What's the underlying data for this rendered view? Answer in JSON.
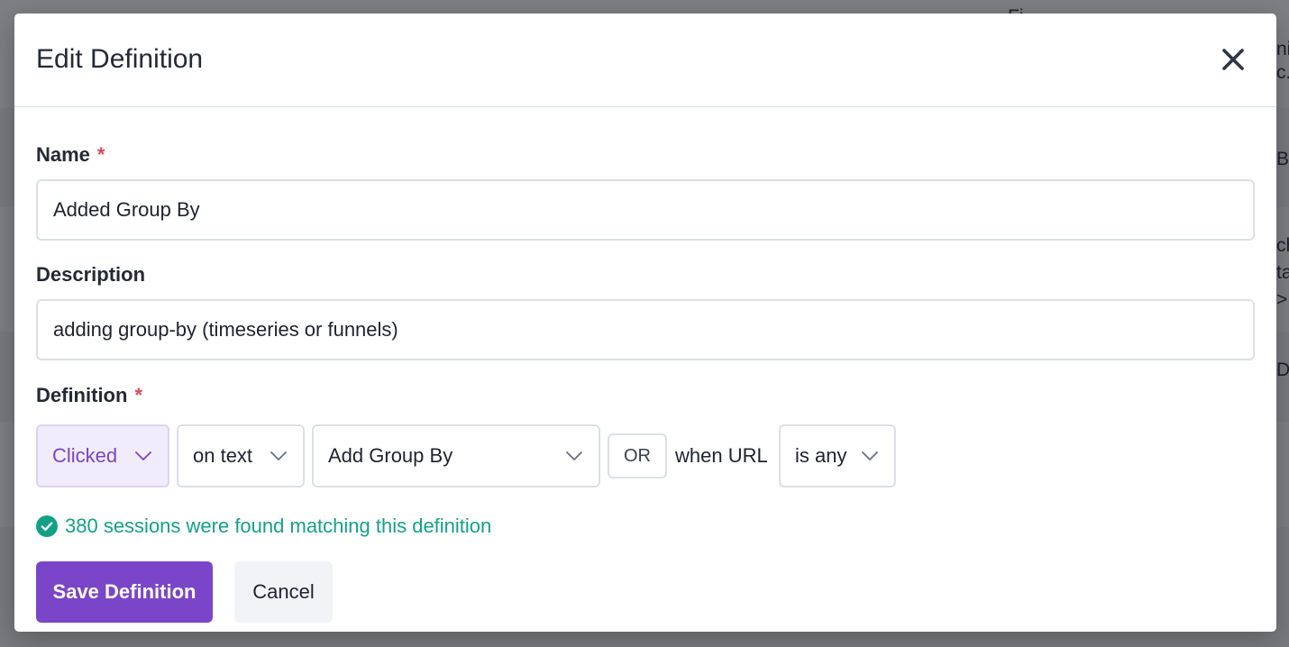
{
  "background": {
    "fragments": [
      "Fi",
      "nil",
      "c.",
      "By",
      "ch",
      "ta",
      ">",
      "D"
    ]
  },
  "modal": {
    "title": "Edit Definition",
    "close_icon": "close-icon",
    "name_field": {
      "label": "Name",
      "required_mark": "*",
      "value": "Added Group By"
    },
    "description_field": {
      "label": "Description",
      "value": "adding group-by (timeseries or funnels)"
    },
    "definition": {
      "label": "Definition",
      "required_mark": "*",
      "event_type": "Clicked",
      "match_mode": "on text",
      "target_text": "Add Group By",
      "or_label": "OR",
      "when_url_label": "when URL",
      "url_operator": "is any"
    },
    "status": {
      "icon": "check-circle-icon",
      "message": "380 sessions were found matching this definition"
    },
    "buttons": {
      "save": "Save Definition",
      "cancel": "Cancel"
    }
  },
  "colors": {
    "accent": "#7a45c8",
    "accent_soft": "#f1ecfb",
    "success": "#14a088",
    "required": "#e0475b"
  }
}
